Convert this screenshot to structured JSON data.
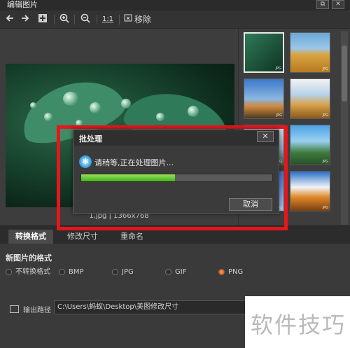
{
  "window": {
    "title": "编辑图片",
    "restore_glyph": "⧉",
    "close_glyph": "✕"
  },
  "toolbar": {
    "back_icon": "arrow-left-icon",
    "forward_icon": "arrow-right-icon",
    "add_icon": "add-icon",
    "zoom_in_icon": "zoom-in-icon",
    "zoom_out_icon": "zoom-out-icon",
    "actual_size_label": "1:1",
    "remove_label": "移除"
  },
  "preview": {
    "caption": "1.jpg | 1366x768"
  },
  "thumbnails": {
    "tag": "JPG"
  },
  "tabs": [
    {
      "label": "转换格式"
    },
    {
      "label": "修改尺寸"
    },
    {
      "label": "重命名"
    }
  ],
  "format": {
    "title": "新图片的格式",
    "options": [
      {
        "label": "不转换格式"
      },
      {
        "label": "BMP"
      },
      {
        "label": "JPG"
      },
      {
        "label": "GIF"
      },
      {
        "label": "PNG"
      }
    ],
    "selected": "PNG"
  },
  "output": {
    "label": "输出路径",
    "path": "C:\\Users\\蚂蚁\\Desktop\\美图修改尺寸"
  },
  "dialog": {
    "title": "批处理",
    "close_glyph": "✕",
    "message": "请稍等,正在处理图片...",
    "progress": 0.49,
    "cancel_label": "取消"
  },
  "watermark": {
    "text": "软件技巧"
  },
  "colors": {
    "progress_green": "#3fb51c",
    "highlight_red": "#e5161c",
    "radio_active": "#e06a10"
  }
}
